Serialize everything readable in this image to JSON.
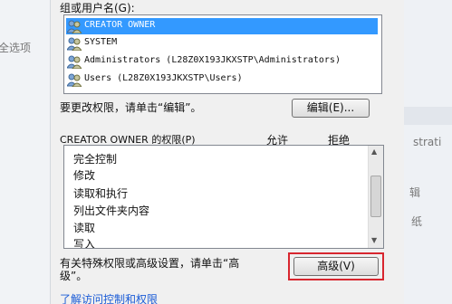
{
  "background": {
    "left_fragment": "全选项",
    "right_fragments": [
      "strati",
      "辑",
      "纸"
    ]
  },
  "group_label": "组或用户名(G):",
  "users": [
    {
      "name": "CREATOR OWNER",
      "icon": "user-group-icon",
      "selected": true
    },
    {
      "name": "SYSTEM",
      "icon": "user-group-icon",
      "selected": false
    },
    {
      "name": "Administrators (L28Z0X193JKXSTP\\Administrators)",
      "icon": "user-group-icon",
      "selected": false
    },
    {
      "name": "Users (L28Z0X193JKXSTP\\Users)",
      "icon": "user-group-icon",
      "selected": false
    }
  ],
  "edit_hint": "要更改权限，请单击“编辑”。",
  "edit_button": "编辑(E)...",
  "perm_header": "CREATOR OWNER 的权限(P)",
  "allow_header": "允许",
  "deny_header": "拒绝",
  "permissions": [
    "完全控制",
    "修改",
    "读取和执行",
    "列出文件夹内容",
    "读取",
    "写入"
  ],
  "advanced_hint_line1": "有关特殊权限或高级设置，请单击“高",
  "advanced_hint_line2": "级”。",
  "advanced_button": "高级(V)",
  "link_text": "了解访问控制和权限",
  "colors": {
    "selection": "#3399ff",
    "highlight_border": "#d8262f",
    "link": "#1a5bd6",
    "dialog_bg": "#f0f0f0"
  }
}
